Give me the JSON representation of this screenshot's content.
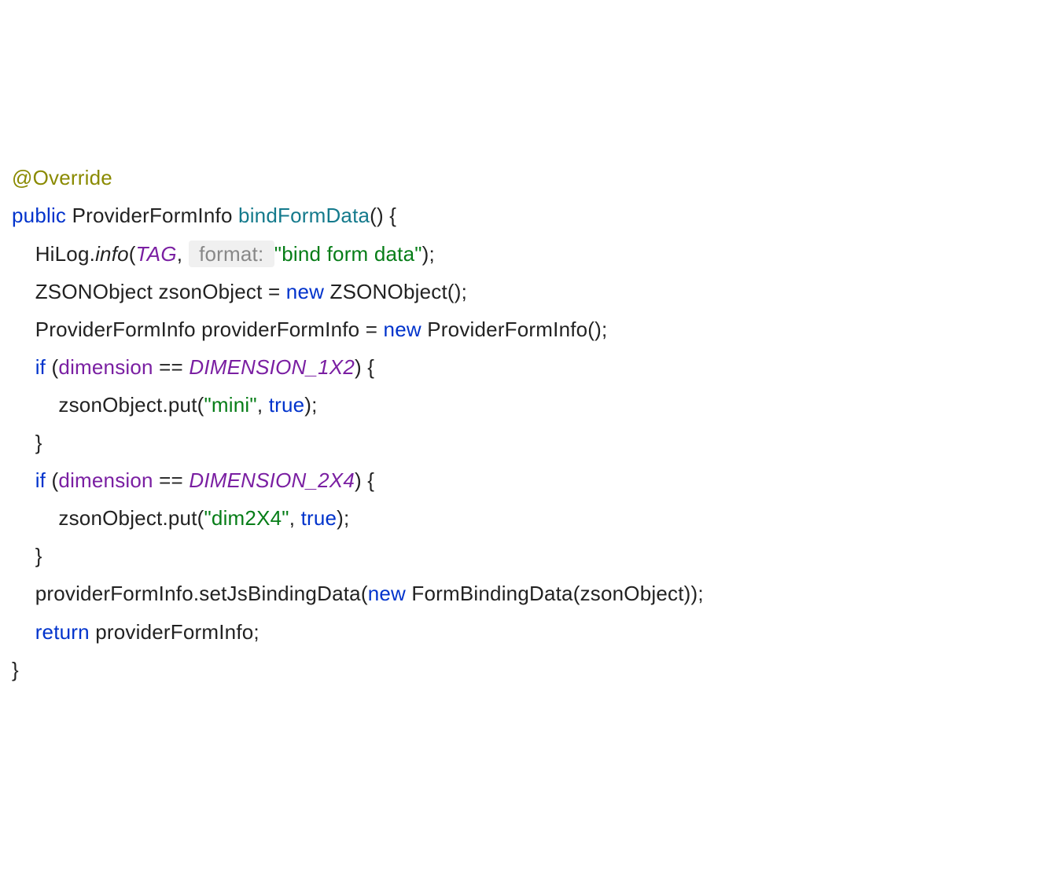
{
  "code": {
    "t1": "@Override",
    "t2": "public",
    "t3": " ProviderFormInfo ",
    "t4": "bindFormData",
    "t5": "() {",
    "t6": "    HiLog.",
    "t7": "info",
    "t8": "(",
    "t9": "TAG",
    "t10": ", ",
    "t11": " format: ",
    "t12": "\"bind form data\"",
    "t13": ");",
    "t14": "    ZSONObject zsonObject = ",
    "t15": "new",
    "t16": " ZSONObject();",
    "t17": "    ProviderFormInfo providerFormInfo = ",
    "t18": "new",
    "t19": " ProviderFormInfo();",
    "t20": "    ",
    "t21": "if",
    "t22": " (",
    "t23": "dimension",
    "t24": " == ",
    "t25": "DIMENSION_1X2",
    "t26": ") {",
    "t27": "        zsonObject.put(",
    "t28": "\"mini\"",
    "t29": ", ",
    "t30": "true",
    "t31": ");",
    "t32": "    }",
    "t33": "    ",
    "t34": "if",
    "t35": " (",
    "t36": "dimension",
    "t37": " == ",
    "t38": "DIMENSION_2X4",
    "t39": ") {",
    "t40": "        zsonObject.put(",
    "t41": "\"dim2X4\"",
    "t42": ", ",
    "t43": "true",
    "t44": ");",
    "t45": "    }",
    "t46": "    providerFormInfo.setJsBindingData(",
    "t47": "new",
    "t48": " FormBindingData(zsonObject));",
    "t49": "    ",
    "t50": "return",
    "t51": " providerFormInfo;",
    "t52": "}"
  }
}
